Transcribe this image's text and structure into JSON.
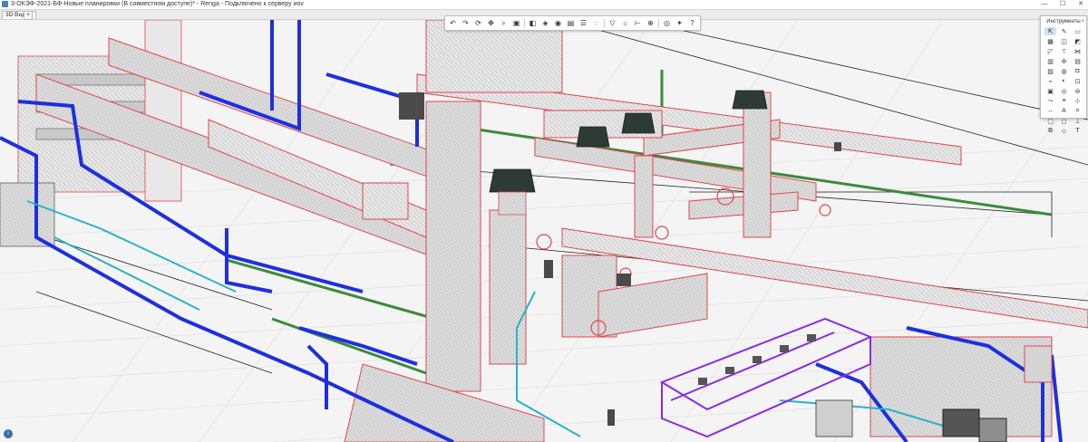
{
  "window": {
    "title": "3-ОКЭФ-2021-БФ-Новые планировки (В совместном доступе)* - Renga - Подключено к серверу иоv",
    "controls": {
      "minimize": "—",
      "maximize": "☐",
      "close": "✕"
    }
  },
  "tabs": [
    {
      "label": "3D Вид",
      "close": "×"
    }
  ],
  "tab_add": "+",
  "toolbar": {
    "buttons": [
      {
        "icon": "undo-icon",
        "glyph": "↶"
      },
      {
        "icon": "redo-icon",
        "glyph": "↷"
      },
      {
        "icon": "orbit-icon",
        "glyph": "⟳"
      },
      {
        "icon": "pan-icon",
        "glyph": "✥"
      },
      {
        "icon": "zoom-icon",
        "glyph": "⌕"
      },
      {
        "icon": "fit-view-icon",
        "glyph": "▣"
      },
      {
        "icon": "section-icon",
        "glyph": "◧"
      },
      {
        "icon": "cube-icon",
        "glyph": "◈"
      },
      {
        "icon": "visibility-icon",
        "glyph": "◉"
      },
      {
        "icon": "display-mode-icon",
        "glyph": "▤"
      },
      {
        "icon": "layers-icon",
        "glyph": "☰"
      },
      {
        "icon": "hide-icon",
        "glyph": "◌"
      },
      {
        "icon": "filter-icon",
        "glyph": "▽"
      },
      {
        "icon": "light-icon",
        "glyph": "☼"
      },
      {
        "icon": "measure-icon",
        "glyph": "⊢"
      },
      {
        "icon": "snap-icon",
        "glyph": "⊕"
      },
      {
        "icon": "camera-icon",
        "glyph": "◎"
      },
      {
        "icon": "settings-icon",
        "glyph": "✦"
      },
      {
        "icon": "help-icon",
        "glyph": "?"
      }
    ]
  },
  "tools_panel": {
    "title": "Инструменты",
    "close": "×",
    "tools": [
      {
        "icon": "select-tool-icon",
        "glyph": "⇱",
        "active": true
      },
      {
        "icon": "draw-tool-icon",
        "glyph": "✎"
      },
      {
        "icon": "rectangle-tool-icon",
        "glyph": "▭"
      },
      {
        "icon": "duct-tool-icon",
        "glyph": "▦"
      },
      {
        "icon": "pipe-tool-icon",
        "glyph": "◫"
      },
      {
        "icon": "fitting-tool-icon",
        "glyph": "◩"
      },
      {
        "icon": "elbow-tool-icon",
        "glyph": "◸"
      },
      {
        "icon": "tee-tool-icon",
        "glyph": "⊤"
      },
      {
        "icon": "valve-tool-icon",
        "glyph": "⋈"
      },
      {
        "icon": "equipment-tool-icon",
        "glyph": "▥"
      },
      {
        "icon": "fan-tool-icon",
        "glyph": "✣"
      },
      {
        "icon": "grille-tool-icon",
        "glyph": "▤"
      },
      {
        "icon": "cable-tray-tool-icon",
        "glyph": "▨"
      },
      {
        "icon": "pump-tool-icon",
        "glyph": "◍"
      },
      {
        "icon": "tank-tool-icon",
        "glyph": "◘"
      },
      {
        "icon": "wiring-tool-icon",
        "glyph": "⌁"
      },
      {
        "icon": "light-fixture-tool-icon",
        "glyph": "◐"
      },
      {
        "icon": "switch-tool-icon",
        "glyph": "⊡"
      },
      {
        "icon": "panel-tool-icon",
        "glyph": "▣"
      },
      {
        "icon": "sensor-tool-icon",
        "glyph": "◎"
      },
      {
        "icon": "socket-tool-icon",
        "glyph": "⊚"
      },
      {
        "icon": "route-tool-icon",
        "glyph": "⤳"
      },
      {
        "icon": "level-tool-icon",
        "glyph": "≡"
      },
      {
        "icon": "axis-tool-icon",
        "glyph": "⊹"
      },
      {
        "icon": "dimension-tool-icon",
        "glyph": "↔"
      },
      {
        "icon": "text-tool-icon",
        "glyph": "A"
      },
      {
        "icon": "tag-tool-icon",
        "glyph": "⌗"
      },
      {
        "icon": "room-tool-icon",
        "glyph": "▢"
      },
      {
        "icon": "opening-tool-icon",
        "glyph": "◻"
      },
      {
        "icon": "support-tool-icon",
        "glyph": "⊥"
      },
      {
        "icon": "assembly-tool-icon",
        "glyph": "⧉"
      },
      {
        "icon": "element-tool-icon",
        "glyph": "◇"
      },
      {
        "icon": "model-text-tool-icon",
        "glyph": "T"
      }
    ]
  },
  "status": {
    "icon": "connection-status-icon",
    "glyph": "i"
  },
  "colors": {
    "duct_fill": "#d9d9d9",
    "duct_edge": "#e0474c",
    "water_pipe": "#1d2fe0",
    "green_pipe": "#3c8a3c",
    "cyan_pipe": "#27b3c6",
    "purple_tray": "#8a2be2",
    "fan_dark": "#2e3b35",
    "grid_line": "#dcdcdc"
  }
}
